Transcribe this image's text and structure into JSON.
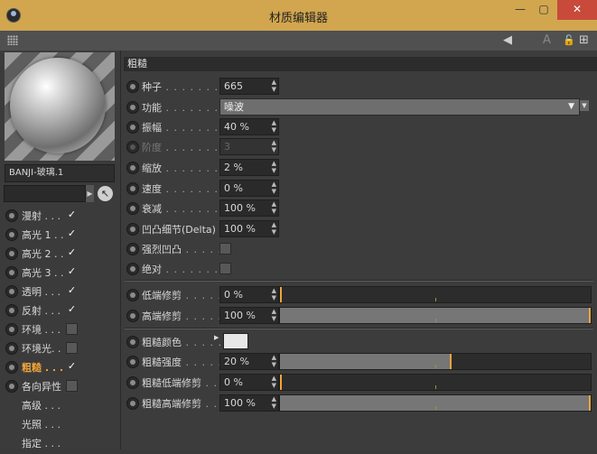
{
  "window": {
    "title": "材质编辑器",
    "min": "—",
    "max": "▢",
    "close": "✕"
  },
  "toolbar": {
    "arrow_icon": "◀",
    "text_icon": "A",
    "lock_icon": "🔓",
    "add_icon": "⊞"
  },
  "material": {
    "name": "BANJI-玻璃.1"
  },
  "channels": [
    {
      "label": "漫射 . . .",
      "checked": true
    },
    {
      "label": "高光 1 . .",
      "checked": true
    },
    {
      "label": "高光 2 . .",
      "checked": true
    },
    {
      "label": "高光 3 . .",
      "checked": true
    },
    {
      "label": "透明 . . .",
      "checked": true
    },
    {
      "label": "反射 . . .",
      "checked": true
    },
    {
      "label": "环境 . . .",
      "checked": false
    },
    {
      "label": "环境光. .",
      "checked": false
    },
    {
      "label": "粗糙 . . .",
      "checked": true,
      "active": true
    },
    {
      "label": "各向异性",
      "checked": false
    }
  ],
  "sub_items": [
    "高级 . . .",
    "光照 . . .",
    "指定 . . ."
  ],
  "section": {
    "title": "粗糙"
  },
  "params": {
    "seed": {
      "label": "种子",
      "value": "665"
    },
    "function": {
      "label": "功能",
      "value": "噪波"
    },
    "amplitude": {
      "label": "振幅",
      "value": "40 %"
    },
    "octaves": {
      "label": "阶度",
      "value": "3"
    },
    "scale": {
      "label": "缩放",
      "value": "2 %"
    },
    "speed": {
      "label": "速度",
      "value": "0 %"
    },
    "attenuation": {
      "label": "衰减",
      "value": "100 %"
    },
    "bump_detail": {
      "label": "凹凸细节(Delta)",
      "value": "100 %"
    },
    "strong_bump": {
      "label": "强烈凹凸"
    },
    "absolute": {
      "label": "绝对"
    },
    "low_clip": {
      "label": "低端修剪",
      "value": "0 %",
      "level": 0.0
    },
    "high_clip": {
      "label": "高端修剪",
      "value": "100 %",
      "level": 1.0
    },
    "rough_color": {
      "label": "粗糙颜色",
      "color": "#e8e8e8"
    },
    "rough_strength": {
      "label": "粗糙强度",
      "value": "20 %",
      "level": 0.55
    },
    "rough_low_clip": {
      "label": "粗糙低端修剪",
      "value": "0 %",
      "level": 0.0
    },
    "rough_high_clip": {
      "label": "粗糙高端修剪",
      "value": "100 %",
      "level": 1.0
    }
  },
  "colors": {
    "accent": "#f0a43a",
    "title_bar": "#d1a64f",
    "close": "#c74a3b"
  }
}
